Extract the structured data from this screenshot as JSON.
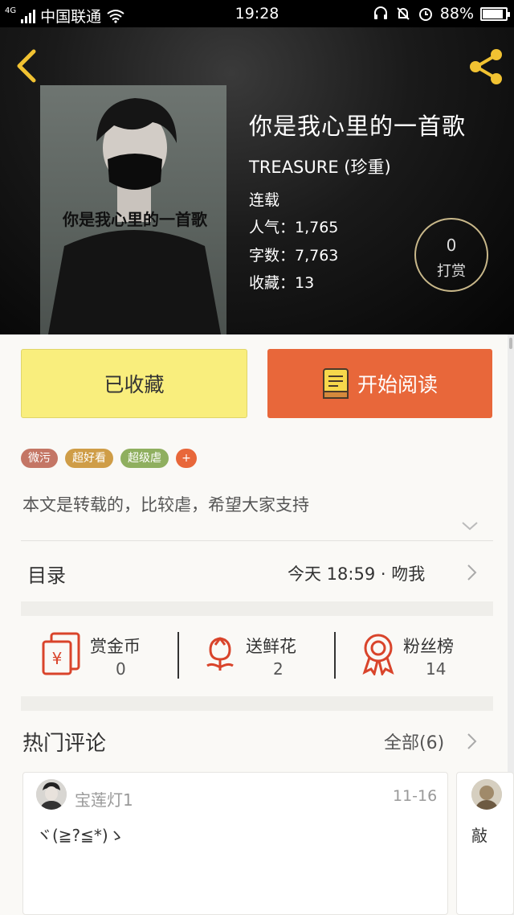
{
  "status_bar": {
    "network": "4G",
    "carrier": "中国联通",
    "time": "19:28",
    "battery": "88%",
    "battery_level": 0.88
  },
  "book": {
    "title": "你是我心里的一首歌",
    "author": "TREASURE (珍重)",
    "cover_title": "你是我心里的一首歌",
    "status": "连载",
    "popularity": "人气：1,765",
    "word_count": "字数：7,763",
    "favorites": "收藏：13",
    "tip_count": "0",
    "tip_label": "打赏"
  },
  "actions": {
    "collect_label": "已收藏",
    "read_label": "开始阅读"
  },
  "tags": [
    {
      "label": "微污",
      "color": "#c47665"
    },
    {
      "label": "超好看",
      "color": "#cf9d47"
    },
    {
      "label": "超级虐",
      "color": "#8faf5f"
    }
  ],
  "tag_add": "+",
  "description": "本文是转载的，比较虐，希望大家支持",
  "toc": {
    "label": "目录",
    "update": "今天 18:59 · 吻我"
  },
  "stats": [
    {
      "label": "赏金币",
      "value": "0",
      "icon": "coin-envelope-icon"
    },
    {
      "label": "送鲜花",
      "value": "2",
      "icon": "flower-icon"
    },
    {
      "label": "粉丝榜",
      "value": "14",
      "icon": "ribbon-medal-icon"
    }
  ],
  "comments": {
    "title": "热门评论",
    "all_label": "全部(6)",
    "items": [
      {
        "user": "宝莲灯1",
        "date": "11-16",
        "text": "ヾ(≧?≦*)ゝ"
      },
      {
        "text": "敲"
      }
    ]
  },
  "colors": {
    "accent": "#e8673a",
    "collect_bg": "#f9ee7d",
    "icon_red": "#d9442b"
  }
}
